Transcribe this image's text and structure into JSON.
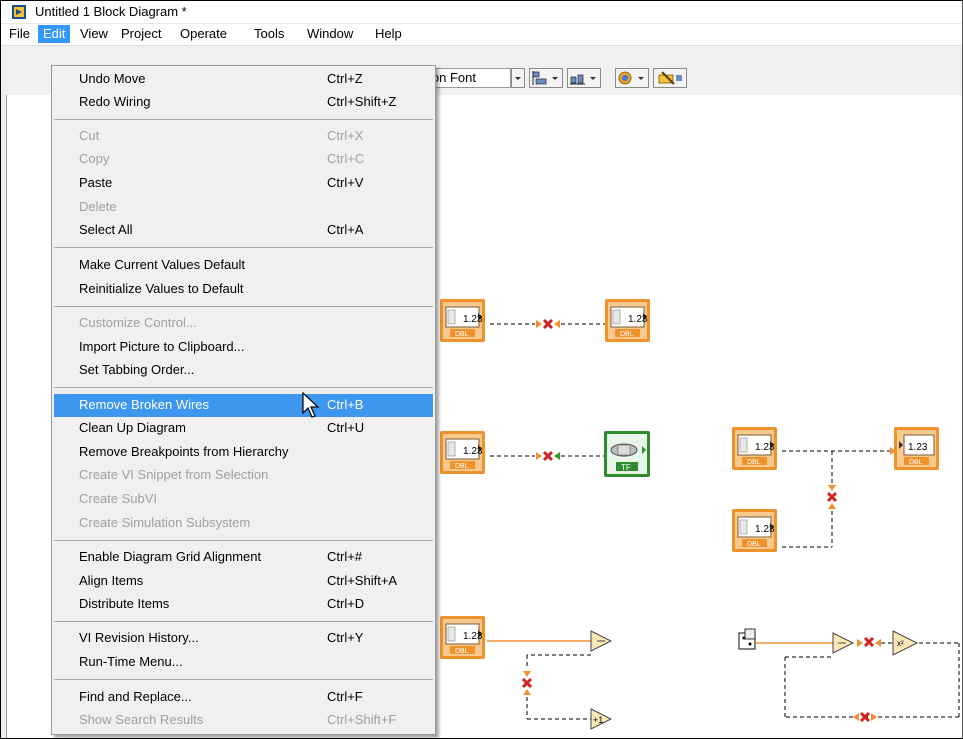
{
  "window": {
    "title": "Untitled 1 Block Diagram *"
  },
  "menubar": {
    "items": [
      "File",
      "Edit",
      "View",
      "Project",
      "Operate",
      "Tools",
      "Window",
      "Help"
    ],
    "active": "Edit"
  },
  "toolbar": {
    "font_field": "ion Font"
  },
  "edit_menu": {
    "groups": [
      [
        {
          "label": "Undo Move",
          "shortcut": "Ctrl+Z",
          "enabled": true
        },
        {
          "label": "Redo Wiring",
          "shortcut": "Ctrl+Shift+Z",
          "enabled": true
        }
      ],
      [
        {
          "label": "Cut",
          "shortcut": "Ctrl+X",
          "enabled": false
        },
        {
          "label": "Copy",
          "shortcut": "Ctrl+C",
          "enabled": false
        },
        {
          "label": "Paste",
          "shortcut": "Ctrl+V",
          "enabled": true
        },
        {
          "label": "Delete",
          "shortcut": "",
          "enabled": false
        },
        {
          "label": "Select All",
          "shortcut": "Ctrl+A",
          "enabled": true
        }
      ],
      [
        {
          "label": "Make Current Values Default",
          "shortcut": "",
          "enabled": true
        },
        {
          "label": "Reinitialize Values to Default",
          "shortcut": "",
          "enabled": true
        }
      ],
      [
        {
          "label": "Customize Control...",
          "shortcut": "",
          "enabled": false
        },
        {
          "label": "Import Picture to Clipboard...",
          "shortcut": "",
          "enabled": true
        },
        {
          "label": "Set Tabbing Order...",
          "shortcut": "",
          "enabled": true
        }
      ],
      [
        {
          "label": "Remove Broken Wires",
          "shortcut": "Ctrl+B",
          "enabled": true,
          "highlighted": true
        },
        {
          "label": "Clean Up Diagram",
          "shortcut": "Ctrl+U",
          "enabled": true
        },
        {
          "label": "Remove Breakpoints from Hierarchy",
          "shortcut": "",
          "enabled": true
        },
        {
          "label": "Create VI Snippet from Selection",
          "shortcut": "",
          "enabled": false
        },
        {
          "label": "Create SubVI",
          "shortcut": "",
          "enabled": false
        },
        {
          "label": "Create Simulation Subsystem",
          "shortcut": "",
          "enabled": false
        }
      ],
      [
        {
          "label": "Enable Diagram Grid Alignment",
          "shortcut": "Ctrl+#",
          "enabled": true
        },
        {
          "label": "Align Items",
          "shortcut": "Ctrl+Shift+A",
          "enabled": true
        },
        {
          "label": "Distribute Items",
          "shortcut": "Ctrl+D",
          "enabled": true
        }
      ],
      [
        {
          "label": "VI Revision History...",
          "shortcut": "Ctrl+Y",
          "enabled": true
        },
        {
          "label": "Run-Time Menu...",
          "shortcut": "",
          "enabled": true
        }
      ],
      [
        {
          "label": "Find and Replace...",
          "shortcut": "Ctrl+F",
          "enabled": true
        },
        {
          "label": "Show Search Results",
          "shortcut": "Ctrl+Shift+F",
          "enabled": false
        }
      ]
    ]
  },
  "diagram": {
    "numeric_label": "1.23",
    "dbl_tag": "DBL",
    "tf_tag": "TF",
    "colors": {
      "numeric_border": "#f0922b",
      "numeric_fill": "#f7c98c",
      "boolean_border": "#2e8b2e",
      "broken_x": "#d02020",
      "wire_orange": "#f09030"
    }
  }
}
